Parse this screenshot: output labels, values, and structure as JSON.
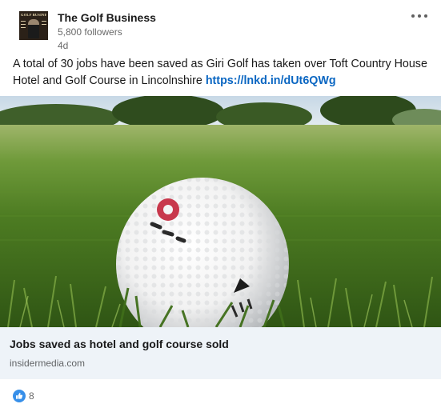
{
  "post": {
    "author": "The Golf Business",
    "followers": "5,800 followers",
    "age": "4d",
    "commentary_text": "A total of 30 jobs have been saved as Giri Golf has taken over Toft Country House Hotel and Golf Course in Lincolnshire",
    "link_text": "https://lnkd.in/dUt6QWg",
    "logo_masthead": "GOLF BUSINESS"
  },
  "article": {
    "title": "Jobs saved as hotel and golf course sold",
    "source": "insidermedia.com"
  },
  "social": {
    "reaction_icon": "like-icon",
    "reaction_count": "8"
  },
  "menu": {
    "icon": "more-options-icon"
  },
  "colors": {
    "link": "#0a66c2",
    "article_bg": "#eef3f8",
    "like_blue": "#378fe9"
  }
}
